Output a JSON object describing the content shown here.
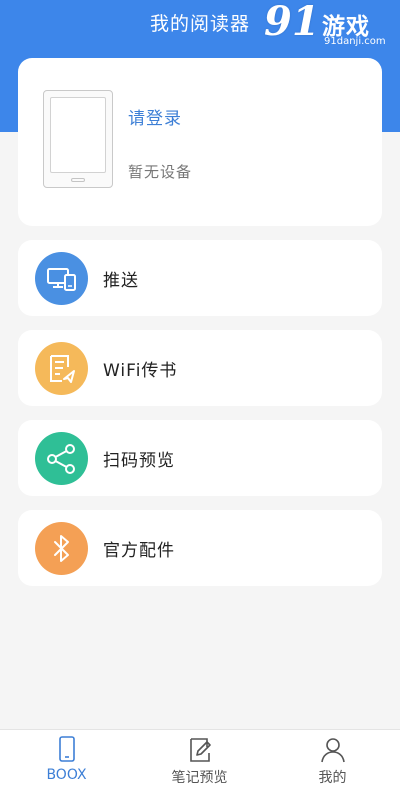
{
  "header": {
    "title": "我的阅读器"
  },
  "watermark": {
    "mark": "91",
    "name": "游戏",
    "domain": "91danji.com"
  },
  "device_card": {
    "login_label": "请登录",
    "status": "暂无设备"
  },
  "menu": {
    "items": [
      {
        "label": "推送",
        "icon": "devices-push-icon",
        "color": "#4a90e2"
      },
      {
        "label": "WiFi传书",
        "icon": "wifi-transfer-note-icon",
        "color": "#f5b95a"
      },
      {
        "label": "扫码预览",
        "icon": "share-icon",
        "color": "#2fbf96"
      },
      {
        "label": "官方配件",
        "icon": "bluetooth-icon",
        "color": "#f4a055"
      }
    ]
  },
  "tabbar": {
    "tabs": [
      {
        "label": "BOOX",
        "icon": "tablet-icon",
        "active": true
      },
      {
        "label": "笔记预览",
        "icon": "note-pen-icon",
        "active": false
      },
      {
        "label": "我的",
        "icon": "user-icon",
        "active": false
      }
    ]
  },
  "colors": {
    "header": "#3d86ea",
    "accent": "#3d7fd6",
    "background": "#f5f5f5"
  }
}
